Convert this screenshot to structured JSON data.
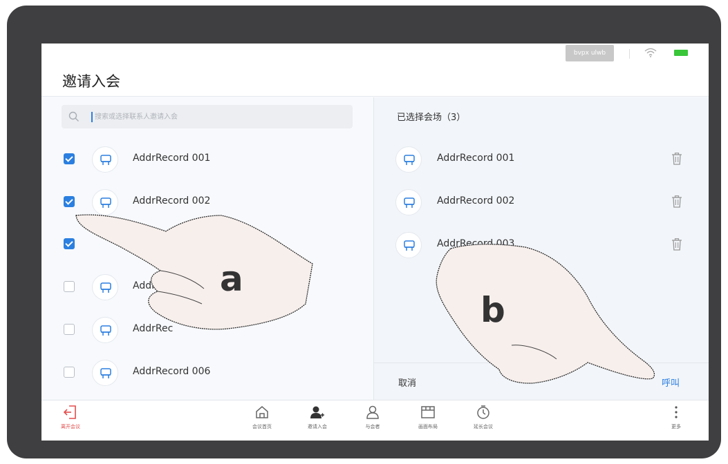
{
  "status_bar": {
    "chip_text": "bvpx ulwb"
  },
  "header": {
    "title": "邀请入会"
  },
  "search": {
    "placeholder": "搜索或选择联系人邀请入会"
  },
  "contacts": [
    {
      "name": "AddrRecord 001",
      "checked": true
    },
    {
      "name": "AddrRecord 002",
      "checked": true
    },
    {
      "name": "",
      "checked": true
    },
    {
      "name": "Addr",
      "checked": false
    },
    {
      "name": "AddrRec",
      "checked": false
    },
    {
      "name": "AddrRecord 006",
      "checked": false
    }
  ],
  "selected": {
    "title": "已选择会场（3）",
    "items": [
      {
        "name": "AddrRecord 001"
      },
      {
        "name": "AddrRecord 002"
      },
      {
        "name": "AddrRecord 003"
      }
    ]
  },
  "footer": {
    "cancel_label": "取消",
    "call_label": "呼叫"
  },
  "toolbar": {
    "leave_label": "离开会议",
    "home_label": "会议首页",
    "invite_label": "邀请入会",
    "participants_label": "与会者",
    "layout_label": "画面布局",
    "extend_label": "延长会议",
    "more_label": "更多"
  },
  "annotations": {
    "step_a": "a",
    "step_b": "b"
  },
  "colors": {
    "accent": "#2b7fe0",
    "leave": "#e34b4b",
    "battery": "#39c639",
    "device": "#3f3f41"
  }
}
